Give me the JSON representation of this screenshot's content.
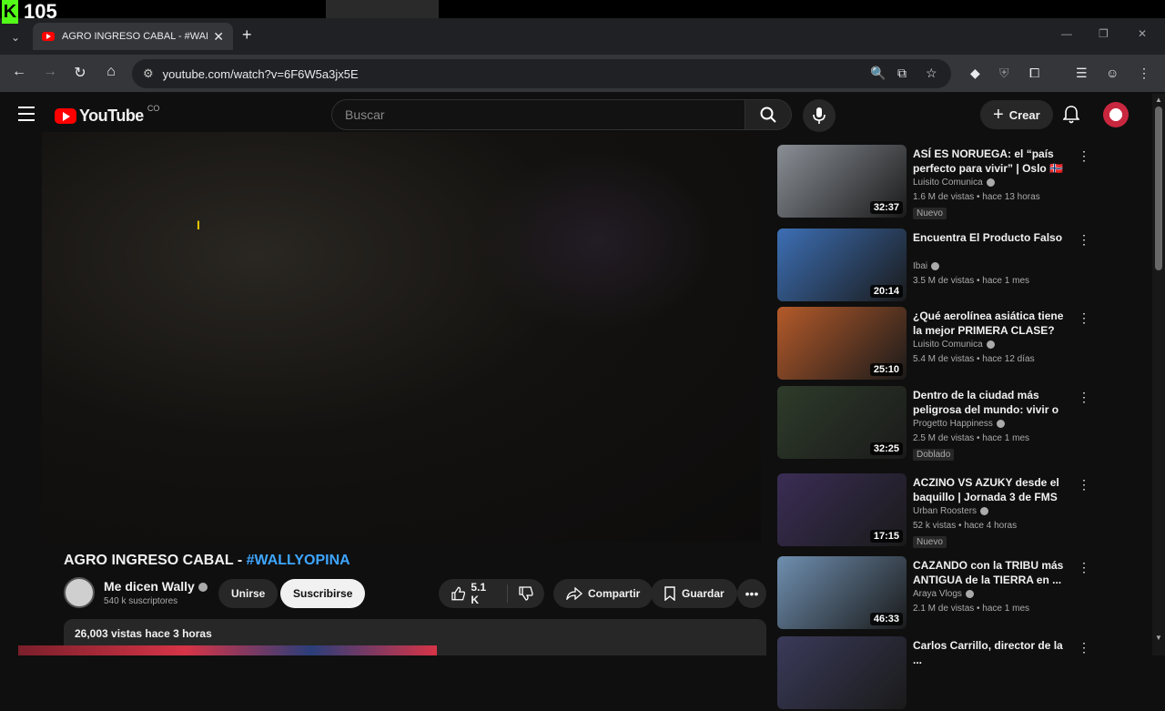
{
  "overlay": {
    "kick_logo": "K",
    "viewer_count": "105"
  },
  "browser": {
    "tab_title": "AGRO INGRESO CABAL - #WALLYO",
    "url": "youtube.com/watch?v=6F6W5a3jx5E",
    "window_controls": [
      "—",
      "❐",
      "✕"
    ]
  },
  "masthead": {
    "logo_text": "YouTube",
    "country_code": "CO",
    "search_placeholder": "Buscar",
    "create_label": "Crear"
  },
  "video": {
    "title_main": "AGRO INGRESO CABAL - ",
    "title_tag": "#WALLYOPINA",
    "channel_name": "Me dicen Wally",
    "subscribers": "540 k suscriptores",
    "join_label": "Unirse",
    "subscribe_label": "Suscribirse",
    "like_count": "5.1 K",
    "share_label": "Compartir",
    "save_label": "Guardar",
    "views_time": "26,003 vistas  hace 3 horas"
  },
  "recommendations": [
    {
      "title": "ASÍ ES NORUEGA: el “país perfecto para vivir” | Oslo 🇳🇴",
      "channel": "Luisito Comunica",
      "meta": "1.6 M de vistas • hace 13 horas",
      "badge": "Nuevo",
      "duration": "32:37",
      "thumb_color": "#8a8f96"
    },
    {
      "title": "Encuentra El Producto Falso",
      "channel": "Ibai",
      "meta": "3.5 M de vistas • hace 1 mes",
      "badge": "",
      "duration": "20:14",
      "thumb_color": "#3c6fb5"
    },
    {
      "title": "¿Qué aerolínea asiática tiene la mejor PRIMERA CLASE? ✈️ 🥘",
      "channel": "Luisito Comunica",
      "meta": "5.4 M de vistas • hace 12 días",
      "badge": "",
      "duration": "25:10",
      "thumb_color": "#b45a2a"
    },
    {
      "title": "Dentro de la ciudad más peligrosa del mundo: vivir o ...",
      "channel": "Progetto Happiness",
      "meta": "2.5 M de vistas • hace 1 mes",
      "badge": "Doblado",
      "duration": "32:25",
      "thumb_color": "#2e3b2a"
    },
    {
      "title": "ACZINO VS AZUKY desde el baquillo | Jornada 3 de FMS ...",
      "channel": "Urban Roosters",
      "meta": "52 k vistas • hace 4 horas",
      "badge": "Nuevo",
      "duration": "17:15",
      "thumb_color": "#3a2d55"
    },
    {
      "title": "CAZANDO con la TRIBU más ANTIGUA de la TIERRA en ...",
      "channel": "Araya Vlogs",
      "meta": "2.1 M de vistas • hace 1 mes",
      "badge": "",
      "duration": "46:33",
      "thumb_color": "#6f8fb0"
    },
    {
      "title": "Carlos Carrillo, director de la ...",
      "channel": "",
      "meta": "",
      "badge": "",
      "duration": "",
      "thumb_color": "#3a3a5a"
    }
  ]
}
